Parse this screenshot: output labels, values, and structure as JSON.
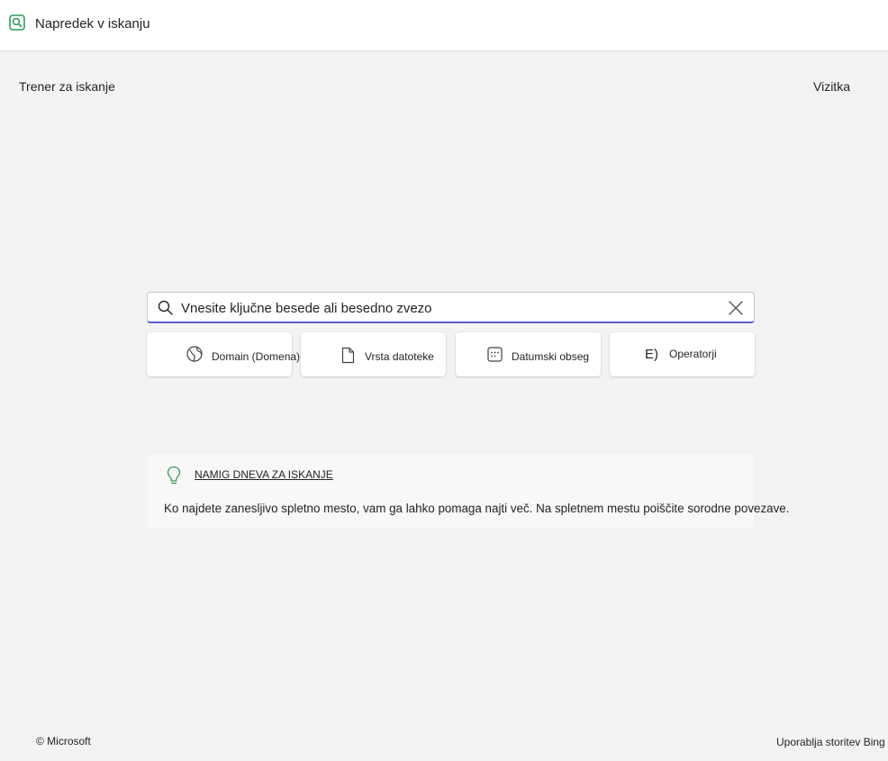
{
  "app": {
    "title": "Napredek v iskanju",
    "icon": "search-app-icon",
    "accent": "#5b5fc7",
    "icon_color": "#2e9e5b"
  },
  "nav": {
    "left_label": "Trener za iskanje",
    "right_label": "Vizitka"
  },
  "search": {
    "placeholder": "Vnesite ključne besede ali besedno zvezo",
    "value": "",
    "icon": "search-icon",
    "clear_icon": "close-icon"
  },
  "filters": [
    {
      "label": "Domain (Domena)",
      "icon": "globe-icon"
    },
    {
      "label": "Vrsta datoteke",
      "icon": "document-icon"
    },
    {
      "label": "Datumski obseg",
      "icon": "calendar-icon"
    },
    {
      "label": "Operatorji",
      "icon_text": "E)"
    }
  ],
  "tip": {
    "icon": "lightbulb-icon",
    "heading": "NAMIG DNEVA ZA ISKANJE",
    "text": "Ko najdete zanesljivo spletno mesto, vam ga lahko pomaga najti več. Na spletnem mestu poiščite sorodne povezave."
  },
  "footer": {
    "copyright": "© Microsoft",
    "powered_by": "Uporablja storitev Bing"
  }
}
